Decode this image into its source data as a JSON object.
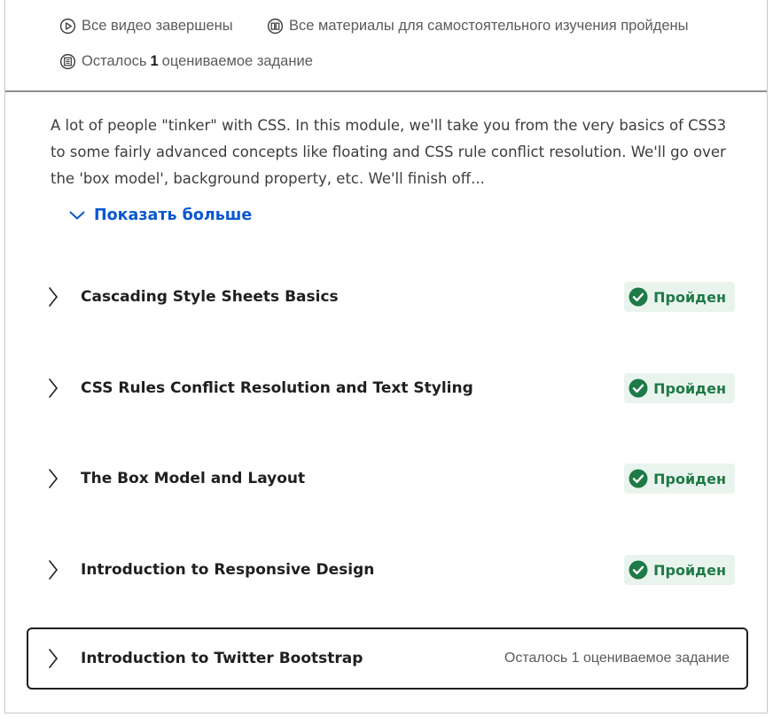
{
  "summary": {
    "videos": "Все видео завершены",
    "readings": "Все материалы для самостоятельного изучения пройдены",
    "graded_prefix": "Осталось",
    "graded_count": "1",
    "graded_suffix": "оцениваемое задание"
  },
  "module": {
    "description": "A lot of people \"tinker\" with CSS. In this module, we'll take you from the very basics of CSS3 to some fairly advanced concepts like floating and CSS rule conflict resolution. We'll go over the 'box model', background property, etc. We'll finish off...",
    "show_more": "Показать больше"
  },
  "lessons": [
    {
      "title": "Cascading Style Sheets Basics",
      "status": "Пройден"
    },
    {
      "title": "CSS Rules Conflict Resolution and Text Styling",
      "status": "Пройден"
    },
    {
      "title": "The Box Model and Layout",
      "status": "Пройден"
    },
    {
      "title": "Introduction to Responsive Design",
      "status": "Пройден"
    },
    {
      "title": "Introduction to Twitter Bootstrap",
      "remaining": "Осталось 1 оцениваемое задание"
    }
  ],
  "colors": {
    "link": "#0b57d0",
    "success": "#1e7a46",
    "success_bg": "#eaf4ee"
  },
  "icons": [
    "play-circle-icon",
    "book-icon",
    "assignment-icon",
    "chevron-down-icon",
    "chevron-right-icon",
    "check-circle-icon"
  ]
}
